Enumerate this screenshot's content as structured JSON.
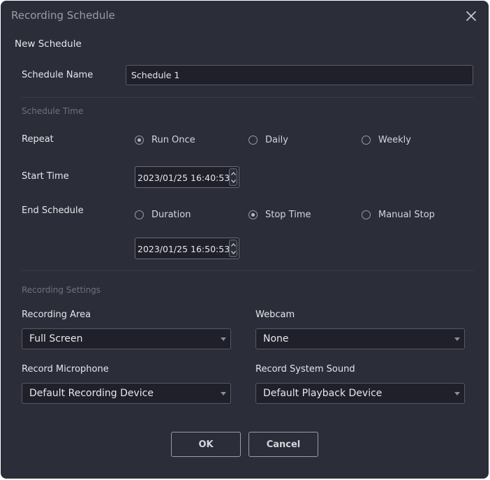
{
  "dialog": {
    "title": "Recording Schedule",
    "heading": "New Schedule"
  },
  "schedule_name": {
    "label": "Schedule Name",
    "value": "Schedule 1"
  },
  "schedule_time": {
    "section_label": "Schedule Time",
    "repeat": {
      "label": "Repeat",
      "options": [
        "Run Once",
        "Daily",
        "Weekly"
      ],
      "selected": "Run Once"
    },
    "start_time": {
      "label": "Start Time",
      "value": "2023/01/25 16:40:53"
    },
    "end_schedule": {
      "label": "End Schedule",
      "options": [
        "Duration",
        "Stop Time",
        "Manual Stop"
      ],
      "selected": "Stop Time",
      "stop_time_value": "2023/01/25 16:50:53"
    }
  },
  "recording_settings": {
    "section_label": "Recording Settings",
    "recording_area": {
      "label": "Recording Area",
      "value": "Full Screen"
    },
    "webcam": {
      "label": "Webcam",
      "value": "None"
    },
    "microphone": {
      "label": "Record Microphone",
      "value": "Default Recording Device"
    },
    "system_sound": {
      "label": "Record System Sound",
      "value": "Default Playback Device"
    }
  },
  "buttons": {
    "ok": "OK",
    "cancel": "Cancel"
  },
  "icons": {
    "close": "close-icon",
    "radio": "radio-icon",
    "spin_up": "chevron-up-icon",
    "spin_down": "chevron-down-icon",
    "dropdown": "dropdown-arrow-icon"
  },
  "colors": {
    "background": "#2b2d38",
    "input_background": "#1f2029",
    "text": "#e6e7ec",
    "muted_text": "#6f727d"
  }
}
